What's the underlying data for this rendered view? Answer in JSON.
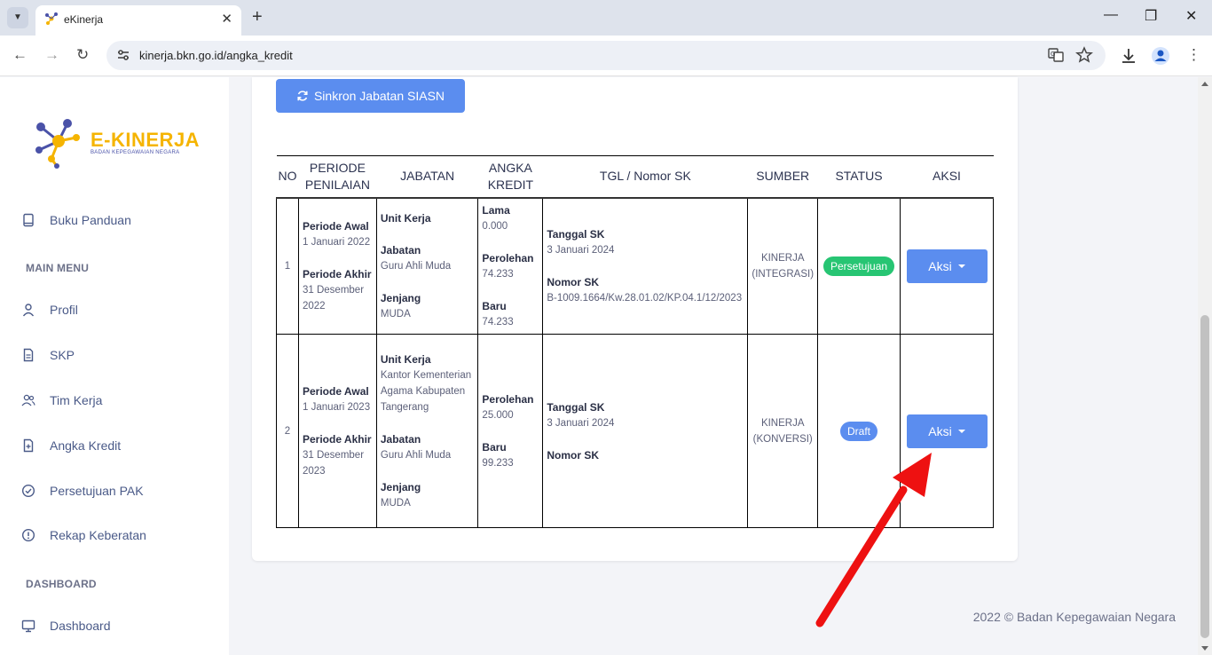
{
  "browser": {
    "tab_title": "eKinerja",
    "url": "kinerja.bkn.go.id/angka_kredit"
  },
  "logo": {
    "title": "E-KINERJA",
    "subtitle": "BADAN KEPEGAWAIAN NEGARA"
  },
  "sidebar": {
    "guide": "Buku Panduan",
    "main_menu_label": "MAIN MENU",
    "items": [
      "Profil",
      "SKP",
      "Tim Kerja",
      "Angka Kredit",
      "Persetujuan PAK",
      "Rekap Keberatan"
    ],
    "dashboard_label": "DASHBOARD",
    "dashboard_item": "Dashboard"
  },
  "sync_button": "Sinkron Jabatan SIASN",
  "table": {
    "headers": [
      "NO",
      "PERIODE PENILAIAN",
      "JABATAN",
      "ANGKA KREDIT",
      "TGL / Nomor SK",
      "SUMBER",
      "STATUS",
      "AKSI"
    ],
    "labels": {
      "periode_awal": "Periode Awal",
      "periode_akhir": "Periode Akhir",
      "unit_kerja": "Unit Kerja",
      "jabatan": "Jabatan",
      "jenjang": "Jenjang",
      "lama": "Lama",
      "perolehan": "Perolehan",
      "baru": "Baru",
      "tanggal_sk": "Tanggal SK",
      "nomor_sk": "Nomor SK"
    },
    "rows": [
      {
        "no": "1",
        "periode_awal": "1 Januari 2022",
        "periode_akhir": "31 Desember 2022",
        "unit_kerja": "",
        "jabatan": "Guru Ahli Muda",
        "jenjang": "MUDA",
        "lama": "0.000",
        "perolehan": "74.233",
        "baru": "74.233",
        "tanggal_sk": "3 Januari 2024",
        "nomor_sk": "B-1009.1664/Kw.28.01.02/KP.04.1/12/2023",
        "sumber": "KINERJA (INTEGRASI)",
        "status": "Persetujuan",
        "aksi": "Aksi"
      },
      {
        "no": "2",
        "periode_awal": "1 Januari 2023",
        "periode_akhir": "31 Desember 2023",
        "unit_kerja": "Kantor Kementerian Agama Kabupaten Tangerang",
        "jabatan": "Guru Ahli Muda",
        "jenjang": "MUDA",
        "perolehan": "25.000",
        "baru": "99.233",
        "tanggal_sk": "3 Januari 2024",
        "nomor_sk": "",
        "sumber": "KINERJA (KONVERSI)",
        "status": "Draft",
        "aksi": "Aksi"
      }
    ]
  },
  "footer": "2022 © Badan Kepegawaian Negara",
  "colors": {
    "primary": "#5b8def",
    "success": "#27c573",
    "nav_text": "#4a5a88",
    "arrow": "#ee1111"
  }
}
